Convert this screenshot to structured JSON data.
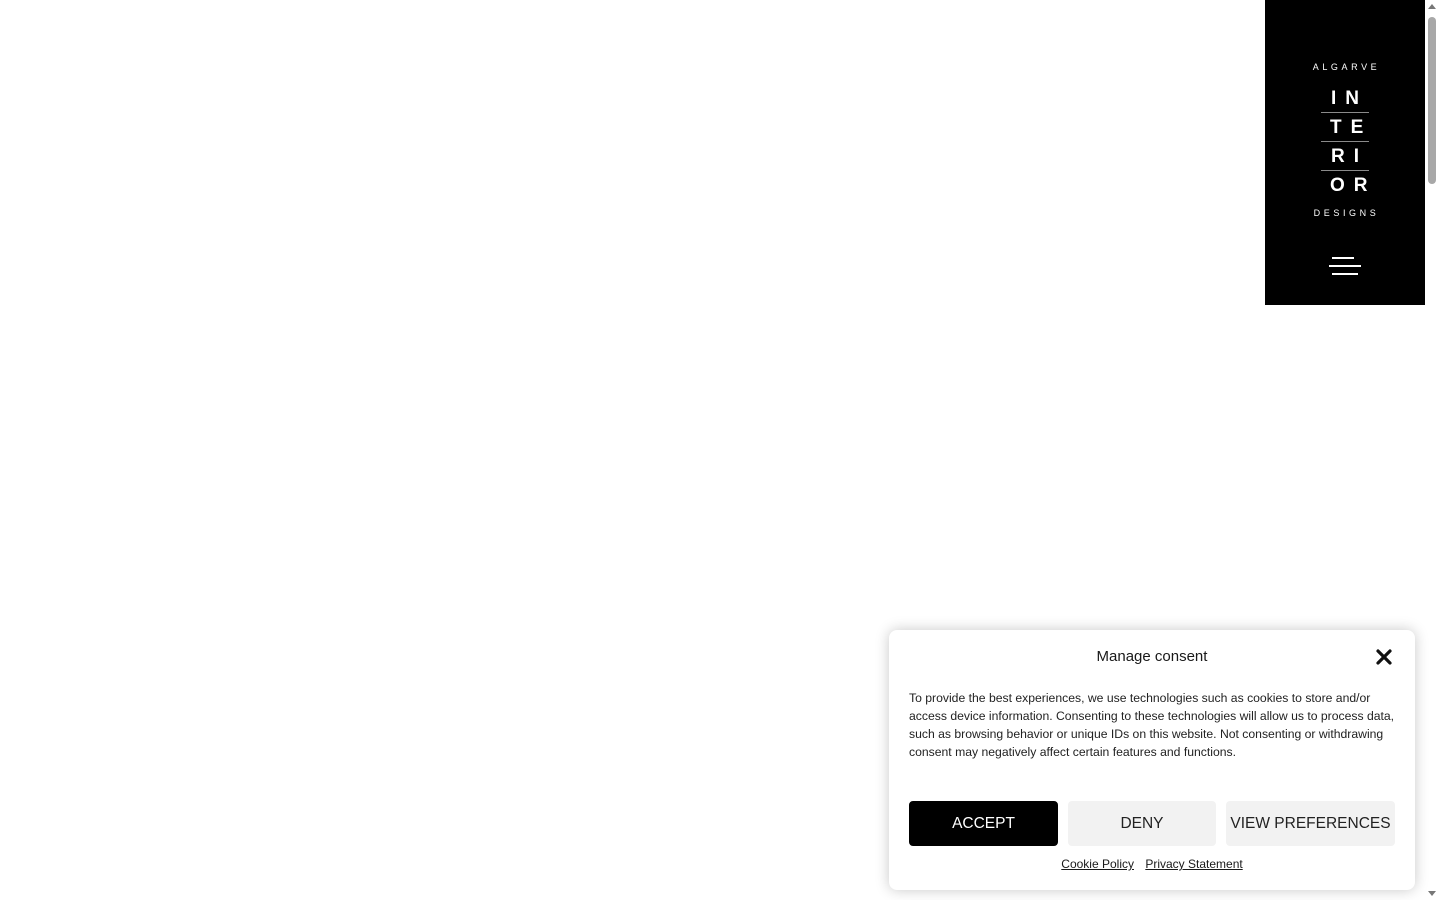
{
  "brand": {
    "top_line": "ALGARVE",
    "letters": [
      "IN",
      "TE",
      "RI",
      "OR"
    ],
    "bottom_line": "DESIGNS",
    "background": "#000000",
    "foreground": "#ffffff"
  },
  "nav": {
    "menu_icon": "hamburger-menu-icon"
  },
  "consent": {
    "title": "Manage consent",
    "close_icon": "close-icon",
    "body": "To provide the best experiences, we use technologies such as cookies to store and/or access device information. Consenting to these technologies will allow us to process data, such as browsing behavior or unique IDs on this website. Not consenting or withdrawing consent may negatively affect certain features and functions.",
    "accept_label": "ACCEPT",
    "deny_label": "DENY",
    "preferences_label": "VIEW PREFERENCES",
    "cookie_policy_label": "Cookie Policy",
    "privacy_statement_label": "Privacy Statement",
    "accept_color": "#000000",
    "secondary_button_color": "#f2f2f2"
  }
}
